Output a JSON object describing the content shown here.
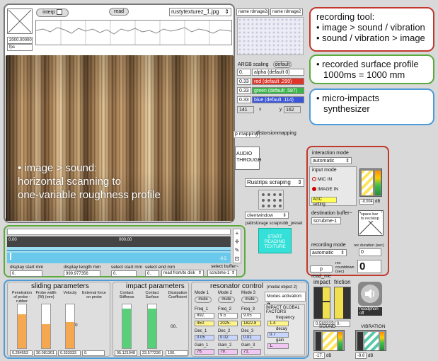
{
  "top": {
    "interp_label": "interp",
    "read_label": "read",
    "file_name": "rustytexturez_1.jpg",
    "rate_value": "2000.00000",
    "rate_unit": "fps"
  },
  "image_overlay": {
    "line1": "• image > sound:",
    "line2": "horizontal scanning to",
    "line3": "one-variable roughness profile"
  },
  "callouts": {
    "red": {
      "title": "recording tool:",
      "item1": "• image > sound / vibration",
      "item2": "• sound / vibration > image"
    },
    "green": {
      "line1": "• recorded surface profile",
      "line2": "1000ms = 1000 mm"
    },
    "blue": {
      "line1": "• micro-impacts",
      "line2": "synthesizer"
    }
  },
  "matrix": {
    "name1": "name rdmage2a",
    "name2": "name rdmage2"
  },
  "argb": {
    "title": "ARGB scaling",
    "default_btn": "default",
    "rows": [
      {
        "value": "0.",
        "label": "alpha (default 0)",
        "color": "#ffffff"
      },
      {
        "value": "0.33",
        "label": "red (default .299)",
        "color": "#e0352a"
      },
      {
        "value": "0.33",
        "label": "green (default .587)",
        "color": "#3ab54a"
      },
      {
        "value": "0.33",
        "label": "blue (default .114)",
        "color": "#3a55d8"
      }
    ],
    "x_value": "141",
    "x_label": "x",
    "y_label": "y",
    "y_value": "162"
  },
  "mapping": {
    "mode1": "p mapping",
    "mode2": "distorsionmapping"
  },
  "audio_btn": "AUDIO THROUGH",
  "scraping": {
    "dropdown": "Rustrips scraping",
    "window": "clientwindow",
    "preset": "pattrstorage scraprubb_preset",
    "start_btn": "START READING TEXTURE"
  },
  "interaction": {
    "mode_label": "interaction mode",
    "mode_value": "automatic",
    "input_label": "input mode",
    "mic": "MIC IN",
    "image": "IMAGE IN",
    "agc": "AGC setting",
    "db_value": "-0.004",
    "db_unit": "dB",
    "dest_label": "destination buffer~",
    "dest_value": "scrubme-1",
    "spacebar": "space bar to rec/stop",
    "rec_mode_label": "recording mode",
    "rec_mode_value": "automatic",
    "rec_duration_label": "rec duration (sec)",
    "rec_duration_value": "0",
    "read_me": "p read_me",
    "countdown_label": "rec countdown (sec)",
    "countdown_value": "0"
  },
  "waveform": {
    "time_start": "0.00",
    "time_mid": "000.00",
    "time_end": "-0.5"
  },
  "selection": {
    "start_mm_label": "display start mm",
    "start_mm": "0.",
    "length_mm_label": "display length mm",
    "length_mm": "999.977356",
    "select_start_label": "select start mm",
    "select_start": "0.",
    "select_end_label": "select end mm",
    "select_end": "0.",
    "read_mode": "read   from/to disk",
    "buffer_label": "select buffer~",
    "buffer_value": "scrubme-1"
  },
  "sliding": {
    "title": "sliding parameters",
    "params": [
      {
        "label": "Penetration of probe - rubber",
        "value": "0.284553",
        "level": 0.78
      },
      {
        "label": "Probe width (W) (mm)",
        "value": "30.081301",
        "level": 0.55
      },
      {
        "label": "Velocity",
        "value": "0.333333",
        "level": 0.6
      },
      {
        "label": "External force on probe",
        "value": "0."
      }
    ],
    "mid_value": "0"
  },
  "impact_params": {
    "title": "impact parameters",
    "params": [
      {
        "label": "Contact Stiffness",
        "value": "95.121948",
        "level": 0.9
      },
      {
        "label": "Contact Surface",
        "value": "23.577236",
        "level": 0.9
      },
      {
        "label": "Dissipation Coefficient",
        "value": "100."
      }
    ],
    "mid_value": "00."
  },
  "resonator": {
    "title": "resonator control",
    "model": "(modal object 2)",
    "modes_label": "Modes activation:",
    "modes_value": "3",
    "modes": [
      {
        "name": "Mode 1",
        "mute": "mute",
        "freq_label": "Freq_1",
        "freq_bar": "892.",
        "freq_val": "450.",
        "dec_label": "Dec_1",
        "dec_val": "0.05",
        "gain_label": "Gain_1",
        "gain_val": "76."
      },
      {
        "name": "Mode 2",
        "mute": "mute",
        "freq_label": "Freq_2",
        "freq_bar": "9.5",
        "freq_val": "2025.",
        "dec_label": "Dec_2",
        "dec_val": "0.02",
        "gain_label": "Gain_2",
        "gain_val": "79."
      },
      {
        "name": "Mode 3",
        "mute": "mute",
        "freq_label": "Freq_3",
        "freq_bar": "9.05",
        "freq_val": "1822.8",
        "dec_label": "Dec_3",
        "dec_val": "0.01",
        "gain_label": "Gain_3",
        "gain_val": "71."
      }
    ],
    "global_title": "IMPACT GLOBAL FACTORS",
    "freq_label": "frequency",
    "freq_val": "1.4",
    "decay_label": "decay",
    "decay_val": "0.7",
    "gain_label": "gain",
    "gain_val": "1."
  },
  "impact_section": {
    "impact_label": "impact",
    "friction_label": "friction",
    "impact_value": "0.583333",
    "friction_value": "0.",
    "headphone_label": "headphon off",
    "sound_label": "SOUND",
    "vibration_label": "VIBRATION",
    "sound_db": "-17.",
    "vib_db": "-9.6",
    "db_unit": "dB"
  }
}
